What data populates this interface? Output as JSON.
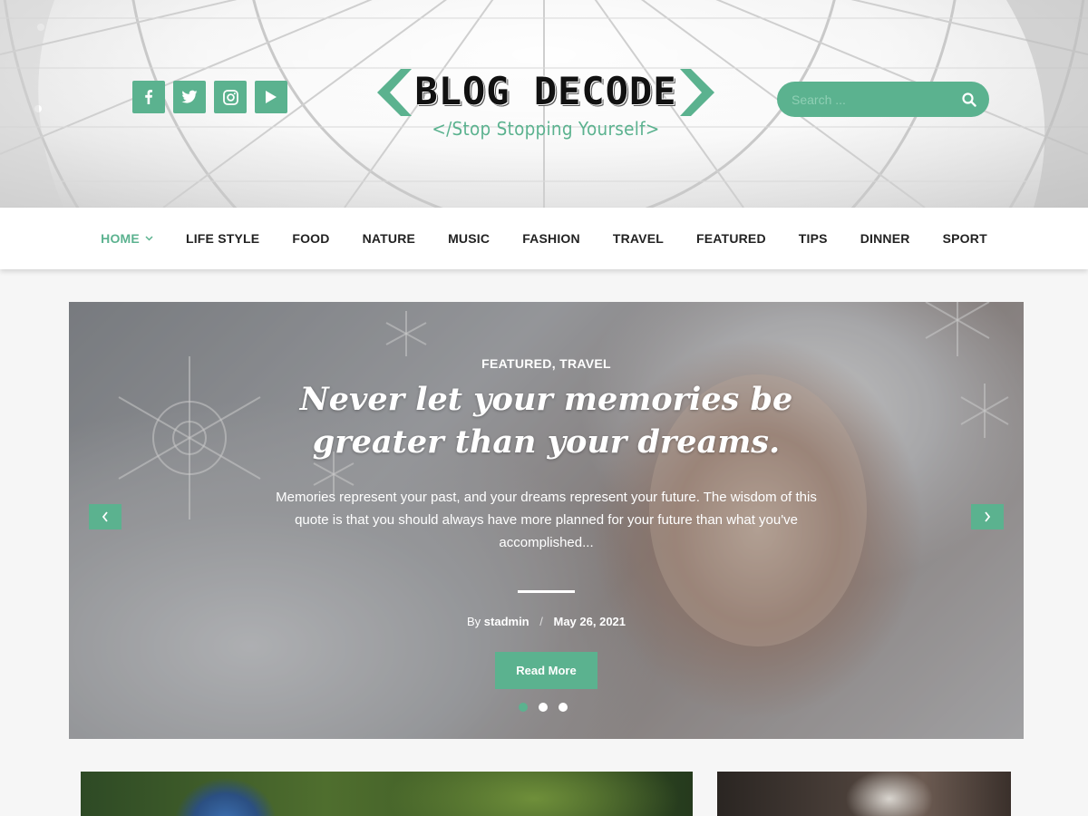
{
  "header": {
    "social": [
      {
        "name": "facebook-icon"
      },
      {
        "name": "twitter-icon"
      },
      {
        "name": "instagram-icon"
      },
      {
        "name": "youtube-icon"
      }
    ],
    "logo_title": "BLOG DECODE",
    "tagline": "</Stop Stopping Yourself>",
    "search_placeholder": "Search ...",
    "accent_color": "#5bb28f"
  },
  "nav": {
    "items": [
      {
        "label": "HOME",
        "active": true
      },
      {
        "label": "LIFE STYLE"
      },
      {
        "label": "FOOD"
      },
      {
        "label": "NATURE"
      },
      {
        "label": "MUSIC"
      },
      {
        "label": "FASHION"
      },
      {
        "label": "TRAVEL"
      },
      {
        "label": "FEATURED"
      },
      {
        "label": "TIPS"
      },
      {
        "label": "DINNER"
      },
      {
        "label": "SPORT"
      }
    ]
  },
  "slider": {
    "categories": "FEATURED, TRAVEL",
    "title": "Never let your memories be greater than your dreams.",
    "excerpt": "Memories represent your past, and your dreams represent your future. The wisdom of this quote is that you should always have more planned for your future than what you've accomplished...",
    "by_label": "By",
    "author": "stadmin",
    "separator": "/",
    "date": "May 26, 2021",
    "read_more": "Read More",
    "dots": 3,
    "active_dot": 0
  }
}
